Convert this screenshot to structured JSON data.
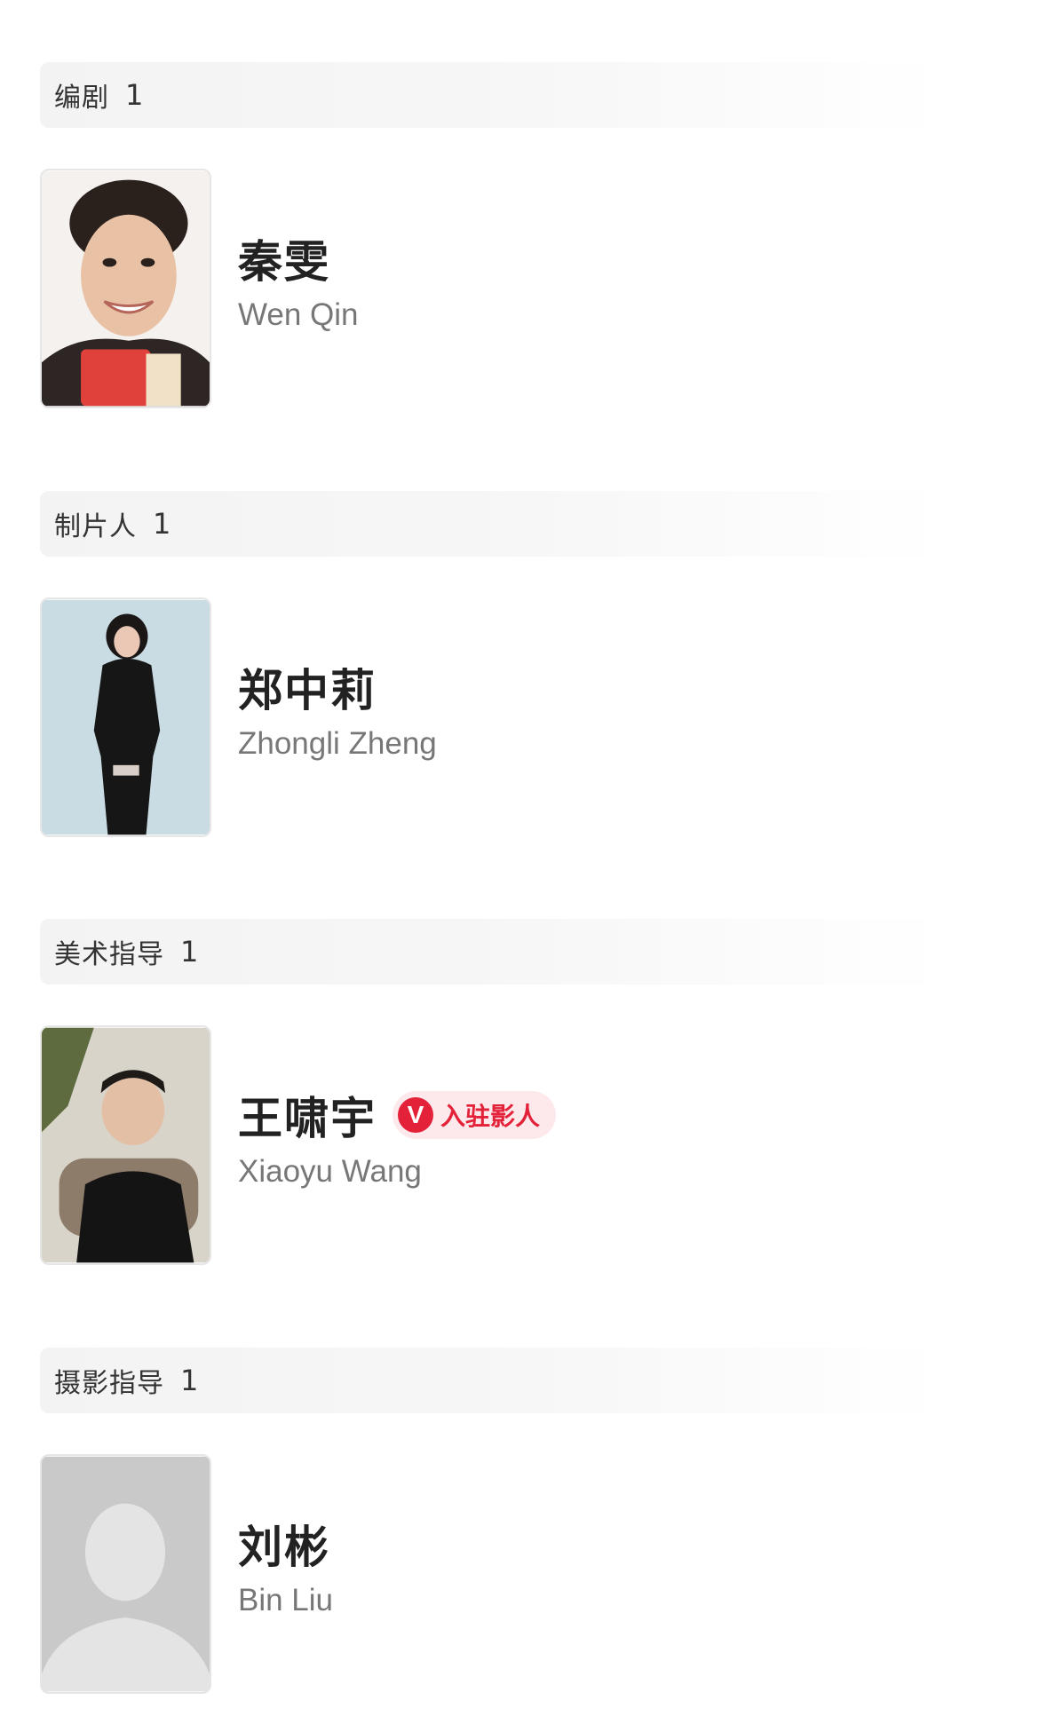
{
  "sections": [
    {
      "role": "编剧",
      "count": "1",
      "person": {
        "name_cn": "秦雯",
        "name_en": "Wen Qin",
        "verified": false
      }
    },
    {
      "role": "制片人",
      "count": "1",
      "person": {
        "name_cn": "郑中莉",
        "name_en": "Zhongli Zheng",
        "verified": false
      }
    },
    {
      "role": "美术指导",
      "count": "1",
      "person": {
        "name_cn": "王啸宇",
        "name_en": "Xiaoyu Wang",
        "verified": true,
        "badge_icon_text": "V",
        "badge_label": "入驻影人"
      }
    },
    {
      "role": "摄影指导",
      "count": "1",
      "person": {
        "name_cn": "刘彬",
        "name_en": "Bin Liu",
        "verified": false
      }
    }
  ],
  "colors": {
    "badge_accent": "#e3223a",
    "badge_background": "#fde9ec",
    "header_background": "#f3f3f3"
  }
}
